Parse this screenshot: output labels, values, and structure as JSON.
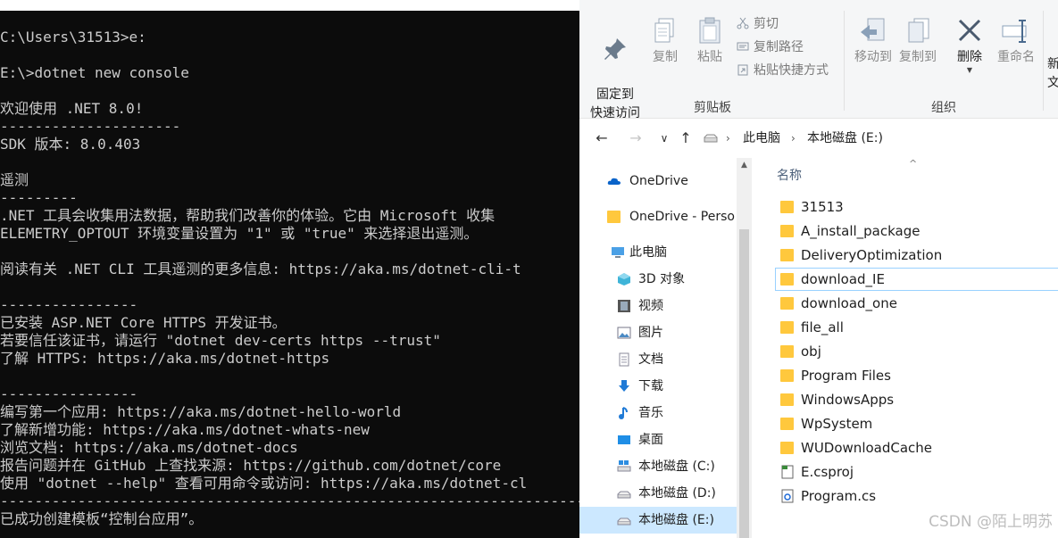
{
  "terminal": {
    "lines": [
      "C:\\Users\\31513>e:",
      "",
      "E:\\>dotnet new console",
      "",
      "欢迎使用 .NET 8.0!",
      "---------------------",
      "SDK 版本: 8.0.403",
      "",
      "遥测",
      "---------",
      ".NET 工具会收集用法数据，帮助我们改善你的体验。它由 Microsoft 收集",
      "ELEMETRY_OPTOUT 环境变量设置为 \"1\" 或 \"true\" 来选择退出遥测。",
      "",
      "阅读有关 .NET CLI 工具遥测的更多信息: https://aka.ms/dotnet-cli-t",
      "",
      "----------------",
      "已安装 ASP.NET Core HTTPS 开发证书。",
      "若要信任该证书，请运行 \"dotnet dev-certs https --trust\"",
      "了解 HTTPS: https://aka.ms/dotnet-https",
      "",
      "----------------",
      "编写第一个应用: https://aka.ms/dotnet-hello-world",
      "了解新增功能: https://aka.ms/dotnet-whats-new",
      "浏览文档: https://aka.ms/dotnet-docs",
      "报告问题并在 GitHub 上查找来源: https://github.com/dotnet/core",
      "使用 \"dotnet --help\" 查看可用命令或访问: https://aka.ms/dotnet-cl",
      "--------------------------------------------------------------------------------------",
      "已成功创建模板“控制台应用”。"
    ]
  },
  "ribbon": {
    "pin_label": "固定到\n快速访问",
    "copy_label": "复制",
    "paste_label": "粘贴",
    "cut_label": "剪切",
    "copy_path_label": "复制路径",
    "paste_shortcut_label": "粘贴快捷方式",
    "clipboard_group": "剪贴板",
    "move_to_label": "移动到",
    "copy_to_label": "复制到",
    "delete_label": "删除",
    "rename_label": "重命名",
    "organize_group": "组织",
    "new_partial_label": "新\n文"
  },
  "address": {
    "crumbs": [
      "此电脑",
      "本地磁盘 (E:)"
    ]
  },
  "nav": {
    "items": [
      {
        "label": "OneDrive",
        "icon": "cloud-icon"
      },
      {
        "label": "OneDrive - Perso",
        "icon": "folder-icon"
      },
      {
        "label": "此电脑",
        "icon": "pc-icon"
      },
      {
        "label": "3D 对象",
        "icon": "3d-objects-icon"
      },
      {
        "label": "视频",
        "icon": "video-icon"
      },
      {
        "label": "图片",
        "icon": "pictures-icon"
      },
      {
        "label": "文档",
        "icon": "documents-icon"
      },
      {
        "label": "下载",
        "icon": "download-icon"
      },
      {
        "label": "音乐",
        "icon": "music-icon"
      },
      {
        "label": "桌面",
        "icon": "desktop-icon"
      },
      {
        "label": "本地磁盘 (C:)",
        "icon": "drive-icon"
      },
      {
        "label": "本地磁盘 (D:)",
        "icon": "drive-icon"
      },
      {
        "label": "本地磁盘 (E:)",
        "icon": "drive-icon",
        "selected": true
      }
    ]
  },
  "files": {
    "column_name": "名称",
    "items": [
      {
        "name": "31513",
        "type": "folder"
      },
      {
        "name": "A_install_package",
        "type": "folder"
      },
      {
        "name": "DeliveryOptimization",
        "type": "folder"
      },
      {
        "name": "download_IE",
        "type": "folder",
        "hovered": true
      },
      {
        "name": "download_one",
        "type": "folder"
      },
      {
        "name": "file_all",
        "type": "folder"
      },
      {
        "name": "obj",
        "type": "folder"
      },
      {
        "name": "Program Files",
        "type": "folder"
      },
      {
        "name": "WindowsApps",
        "type": "folder"
      },
      {
        "name": "WpSystem",
        "type": "folder"
      },
      {
        "name": "WUDownloadCache",
        "type": "folder"
      },
      {
        "name": "E.csproj",
        "type": "csproj"
      },
      {
        "name": "Program.cs",
        "type": "cs"
      }
    ]
  },
  "watermark": "CSDN @陌上明苏",
  "colors": {
    "terminal_bg": "#0c0c0c",
    "terminal_text": "#cccccc",
    "folder": "#ffc83d",
    "selection": "#cce8ff"
  }
}
